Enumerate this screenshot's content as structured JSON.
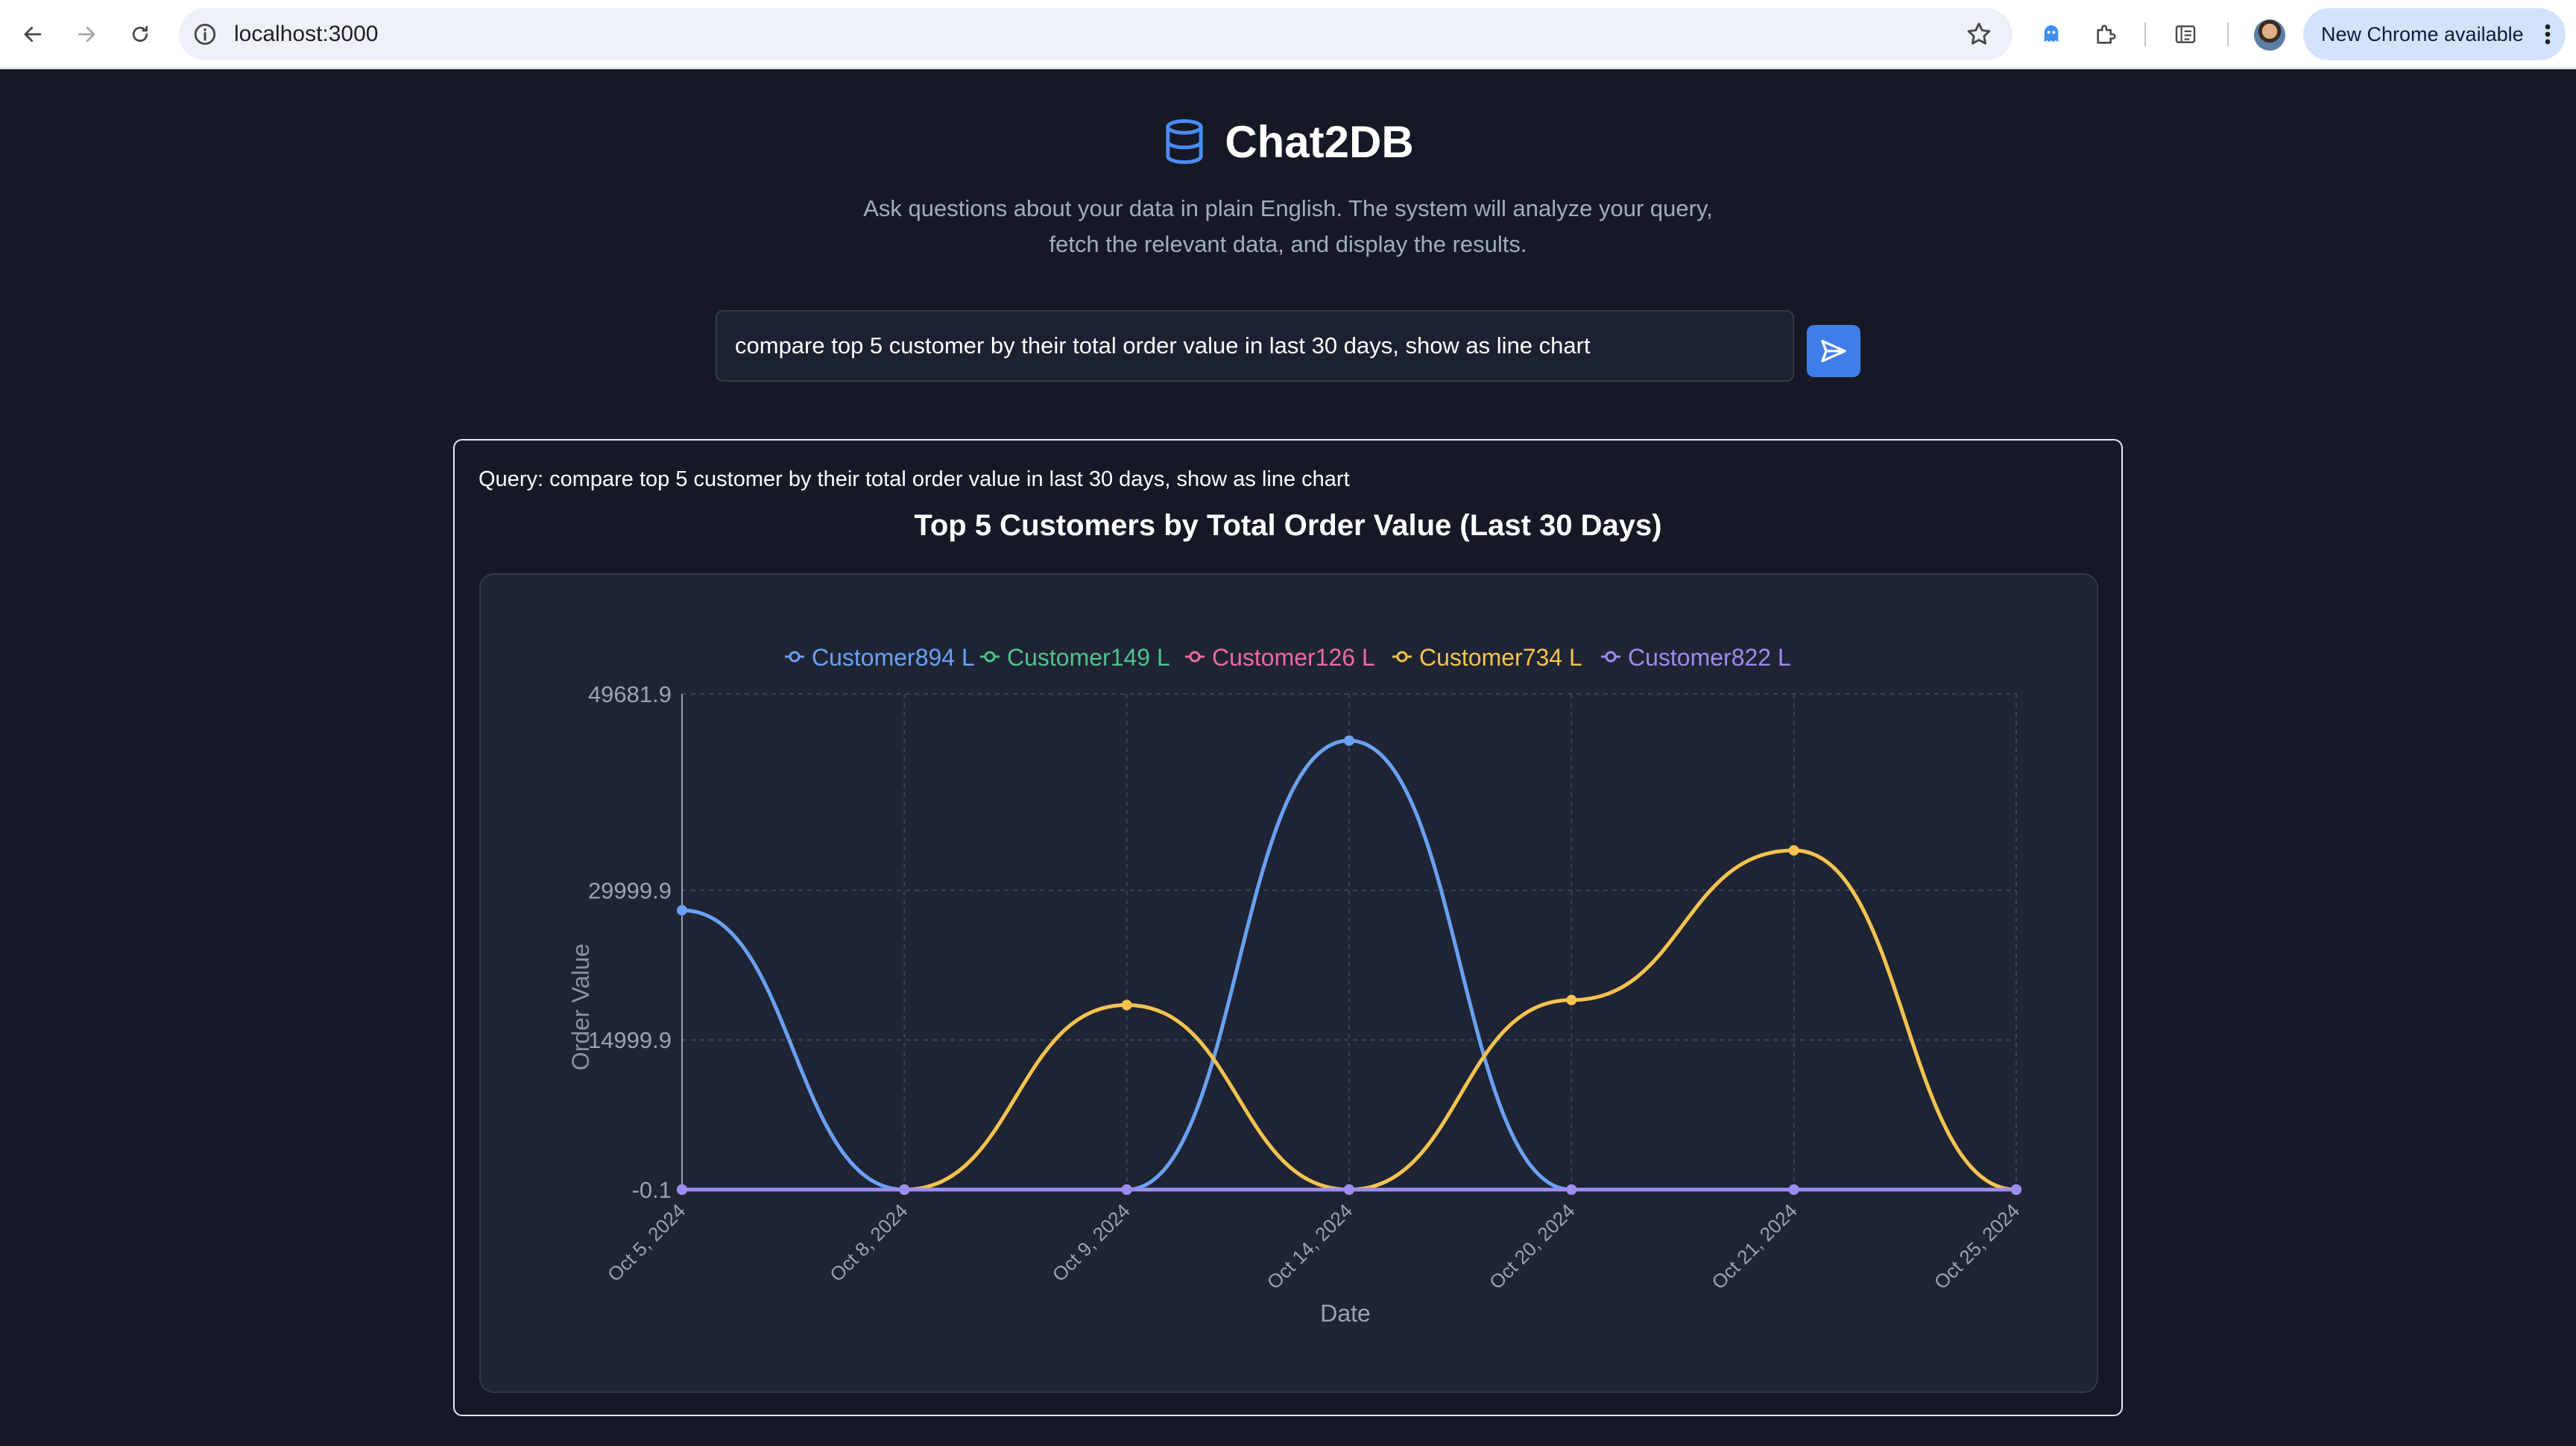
{
  "browser": {
    "url": "localhost:3000",
    "update_label": "New Chrome available"
  },
  "header": {
    "title": "Chat2DB",
    "subtitle": "Ask questions about your data in plain English. The system will analyze your query, fetch the relevant data, and display the results."
  },
  "query": {
    "value": "compare top 5 customer by their total order value in last 30 days, show as line chart"
  },
  "result": {
    "query_label": "Query: compare top 5 customer by their total order value in last 30 days, show as line chart"
  },
  "colors": {
    "Customer894": "#6aa1f3",
    "Customer149": "#4fc38a",
    "Customer126": "#ee6b9e",
    "Customer734": "#f5c350",
    "Customer822": "#9d8cf0"
  },
  "chart_data": {
    "type": "line",
    "title": "Top 5 Customers by Total Order Value (Last 30 Days)",
    "xlabel": "Date",
    "ylabel": "Order Value",
    "x": [
      "Oct 5, 2024",
      "Oct 8, 2024",
      "Oct 9, 2024",
      "Oct 14, 2024",
      "Oct 20, 2024",
      "Oct 21, 2024",
      "Oct 25, 2024"
    ],
    "ylim": [
      -0.1,
      49681.9
    ],
    "yticks": [
      "49681.9",
      "29999.9",
      "14999.9",
      "-0.1"
    ],
    "grid": true,
    "legend_position": "top",
    "legend_suffix": " L",
    "series": [
      {
        "name": "Customer894",
        "values": [
          28000,
          0,
          0,
          45000,
          0,
          0,
          0
        ]
      },
      {
        "name": "Customer149",
        "values": [
          0,
          0,
          0,
          0,
          0,
          0,
          0
        ]
      },
      {
        "name": "Customer126",
        "values": [
          0,
          0,
          0,
          0,
          0,
          0,
          0
        ]
      },
      {
        "name": "Customer734",
        "values": [
          0,
          0,
          18500,
          0,
          19000,
          34000,
          0
        ]
      },
      {
        "name": "Customer822",
        "values": [
          0,
          0,
          0,
          0,
          0,
          0,
          0
        ]
      }
    ]
  }
}
